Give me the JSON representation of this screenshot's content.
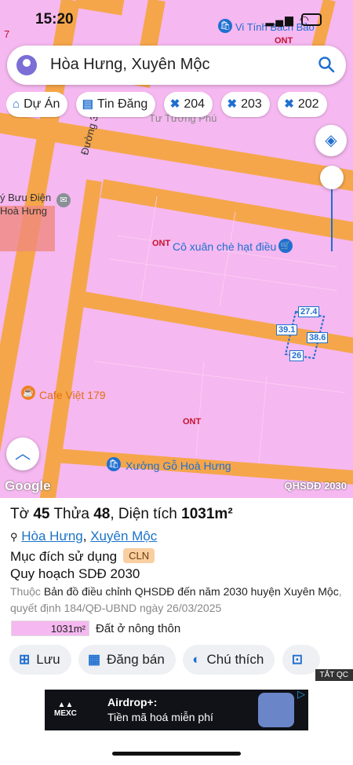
{
  "status": {
    "time": "15:20"
  },
  "search": {
    "value": "Hòa Hưng, Xuyên Mộc"
  },
  "chips": [
    {
      "label": "Dự Án",
      "icon": "house-icon"
    },
    {
      "label": "Tin Đăng",
      "icon": "listing-icon"
    },
    {
      "label": "204",
      "icon": "grid-icon"
    },
    {
      "label": "203",
      "icon": "grid-icon"
    },
    {
      "label": "202",
      "icon": "grid-icon"
    }
  ],
  "map": {
    "road_label": "Đường 328",
    "post_office": "ý Bưu Điện\nHoà Hưng",
    "shop_top": "Vi Tính Bách Bảo",
    "shop_faded": "Tư Tường Phú",
    "shop_mid": "Cô xuân chè hạt điều",
    "cafe": "Cafe Việt 179",
    "workshop": "Xưởng Gỗ Hoà Hưng",
    "ont_labels": [
      "ONT",
      "ONT",
      "ONT"
    ],
    "dimensions": {
      "top": "27.4",
      "left": "39.1",
      "right": "38.6",
      "bottom": "26"
    },
    "google": "Google",
    "overlay": "QHSDĐ 2030",
    "corner_mark": "7"
  },
  "parcel": {
    "to_label": "Tờ",
    "to": "45",
    "thua_label": "Thửa",
    "thua": "48",
    "area_label": "Diện tích",
    "area": "1031m²",
    "commune": "Hòa Hưng",
    "district": "Xuyên Mộc",
    "purpose_label": "Mục đích sử dụng",
    "purpose_code": "CLN",
    "plan_title": "Quy hoạch SDĐ 2030",
    "desc_prefix": "Thuộc",
    "desc_map": "Bản đồ điều chỉnh QHSDĐ đến năm 2030 huyện Xuyên Mộc",
    "desc_decision": ", quyết định 184/QĐ-UBND ngày 26/03/2025",
    "legend_area": "1031m²",
    "legend_text": "Đất ở nông thôn"
  },
  "actions": [
    {
      "label": "Lưu",
      "icon": "save-plus-icon"
    },
    {
      "label": "Đăng bán",
      "icon": "post-icon"
    },
    {
      "label": "Chú thích",
      "icon": "half-circle-icon"
    },
    {
      "label": "",
      "icon": "camera-icon"
    }
  ],
  "ad": {
    "tag": "TẮT QC",
    "brand": "MEXC",
    "title": "Airdrop+:",
    "subtitle": "Tiền mã hoá miễn phí"
  },
  "colors": {
    "land": "#f5b8f0",
    "road": "#f5a64a",
    "accent": "#1f6fd1"
  }
}
